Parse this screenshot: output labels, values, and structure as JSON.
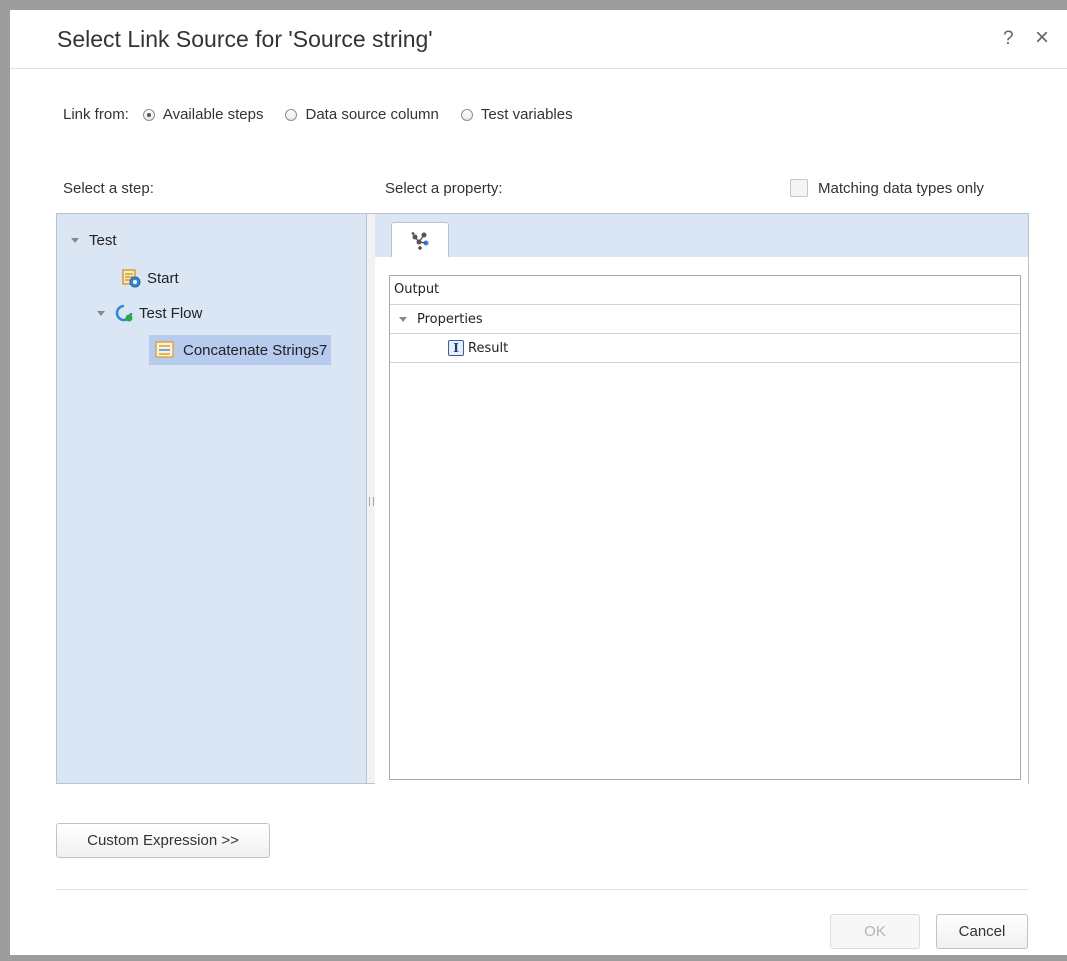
{
  "dialog": {
    "title": "Select Link Source for 'Source string'",
    "help_glyph": "?",
    "close_glyph": "×"
  },
  "link_from": {
    "label": "Link from:",
    "options": [
      {
        "label": "Available steps",
        "checked": true
      },
      {
        "label": "Data source column",
        "checked": false
      },
      {
        "label": "Test variables",
        "checked": false
      }
    ]
  },
  "step_panel": {
    "label": "Select a step:",
    "tree": {
      "root": "Test",
      "start": "Start",
      "flow": "Test Flow",
      "selected_step": "Concatenate Strings7"
    }
  },
  "property_panel": {
    "label": "Select a property:",
    "matching_label": "Matching data types only",
    "matching_checked": false,
    "tab_icon": "link-nodes-icon",
    "table": {
      "header": "Output",
      "group": "Properties",
      "item": "Result",
      "item_icon_glyph": "I"
    }
  },
  "footer": {
    "custom_expression": "Custom Expression >>",
    "ok": "OK",
    "cancel": "Cancel"
  },
  "colors": {
    "pane_bg": "#dbe6f4",
    "selection": "#b6cbee",
    "frame": "#9d9d9d"
  }
}
